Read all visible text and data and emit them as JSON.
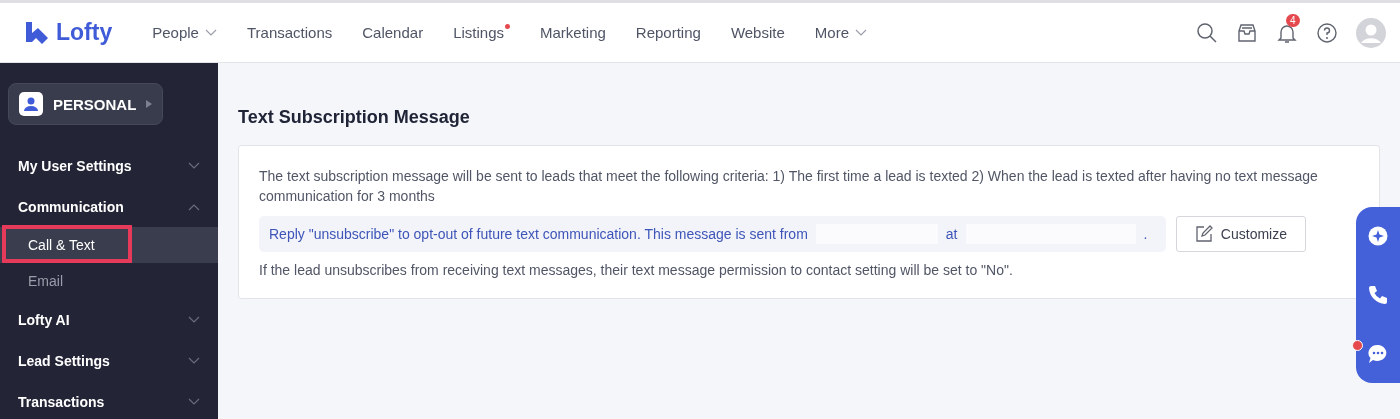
{
  "brand": {
    "name": "Lofty"
  },
  "nav": [
    {
      "label": "People",
      "dropdown": true,
      "dot": false
    },
    {
      "label": "Transactions",
      "dropdown": false,
      "dot": false
    },
    {
      "label": "Calendar",
      "dropdown": false,
      "dot": false
    },
    {
      "label": "Listings",
      "dropdown": false,
      "dot": true
    },
    {
      "label": "Marketing",
      "dropdown": false,
      "dot": false
    },
    {
      "label": "Reporting",
      "dropdown": false,
      "dot": false
    },
    {
      "label": "Website",
      "dropdown": false,
      "dot": false
    },
    {
      "label": "More",
      "dropdown": true,
      "dot": false
    }
  ],
  "notifications": {
    "count": "4"
  },
  "sidebar": {
    "account": "PERSONAL",
    "sections": [
      {
        "label": "My User Settings",
        "expanded": false
      },
      {
        "label": "Communication",
        "expanded": true,
        "children": [
          {
            "label": "Call & Text",
            "selected": true,
            "highlighted": true
          },
          {
            "label": "Email",
            "selected": false,
            "highlighted": false
          }
        ]
      },
      {
        "label": "Lofty AI",
        "expanded": false
      },
      {
        "label": "Lead Settings",
        "expanded": false
      },
      {
        "label": "Transactions",
        "expanded": false
      }
    ]
  },
  "page": {
    "title": "Text Subscription Message",
    "description": "The text subscription message will be sent to leads that meet the following criteria: 1) The first time a lead is texted 2) When the lead is texted after having no text message communication for 3 months",
    "message_parts": [
      "Reply \"unsubscribe\" to opt-out of future text communication. This message is sent from",
      "at",
      "."
    ],
    "customize_button": "Customize",
    "footnote": "If the lead unsubscribes from receiving text messages, their text message permission to contact setting will be set to \"No\"."
  },
  "floating_panel": {
    "chat_unread": true
  }
}
